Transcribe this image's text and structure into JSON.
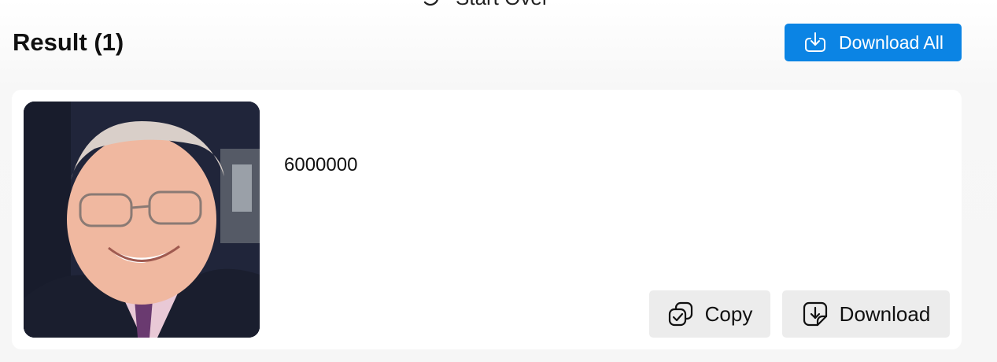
{
  "header": {
    "start_over_label": "Start Over",
    "result_title": "Result (1)",
    "download_all_label": "Download All"
  },
  "results": [
    {
      "value": "6000000",
      "copy_label": "Copy",
      "download_label": "Download"
    }
  ],
  "colors": {
    "primary": "#0b84e4",
    "secondary_button": "#ececec",
    "background": "#f6f6f6",
    "card": "#ffffff"
  },
  "icons": {
    "start_over": "refresh-icon",
    "download_all": "cloud-download-icon",
    "copy": "copy-icon",
    "download": "file-download-icon"
  }
}
